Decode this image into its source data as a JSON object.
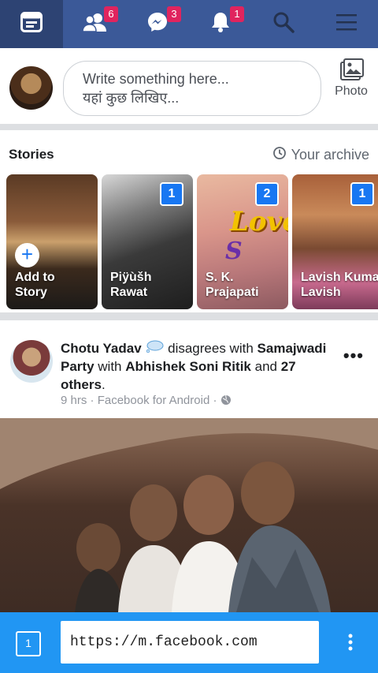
{
  "topbar": {
    "tabs": [
      {
        "icon": "news-feed-icon",
        "badge": null
      },
      {
        "icon": "friends-icon",
        "badge": "6"
      },
      {
        "icon": "messenger-icon",
        "badge": "3"
      },
      {
        "icon": "notifications-icon",
        "badge": "1"
      },
      {
        "icon": "search-icon",
        "badge": null
      },
      {
        "icon": "menu-icon",
        "badge": null
      }
    ],
    "color": "#3b5998"
  },
  "composer": {
    "placeholder_line1": "Write something here...",
    "placeholder_line2": "यहां कुछ लिखिए...",
    "photo_label": "Photo"
  },
  "stories": {
    "title": "Stories",
    "archive_label": "Your archive",
    "items": [
      {
        "name_line1": "Add to",
        "name_line2": "Story",
        "count": null
      },
      {
        "name_line1": "Piÿùšh",
        "name_line2": "Rawat",
        "count": "1"
      },
      {
        "name_line1": "S. K.",
        "name_line2": "Prajapati",
        "count": "2"
      },
      {
        "name_line1": "Lavish Kumar",
        "name_line2": "Lavish",
        "count": "1"
      }
    ],
    "story3_sticker": "Love",
    "story3_letter": "S"
  },
  "post": {
    "author": "Chotu Yadav",
    "action": "disagrees with",
    "page": "Samajwadi Party",
    "with": "with",
    "tagged": "Abhishek Soni Ritik",
    "and": "and",
    "others": "27 others",
    "time": "9 hrs",
    "source": "Facebook for Android",
    "dot": "·"
  },
  "browser": {
    "url": "https://m.facebook.com",
    "tab_count": "1",
    "color": "#2196f3"
  }
}
